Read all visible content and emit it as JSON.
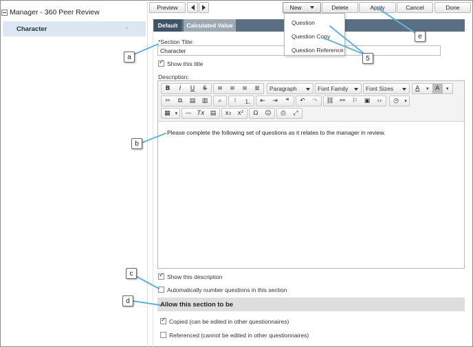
{
  "tree": {
    "root_label": "Manager - 360 Peer Review",
    "selected_item": "Character",
    "item_marker": "*"
  },
  "toolbar": {
    "preview": "Preview",
    "new": "New",
    "delete": "Delete",
    "apply": "Apply",
    "cancel": "Cancel",
    "done": "Done"
  },
  "new_menu": {
    "items": [
      "Question",
      "Question Copy",
      "Question Reference"
    ]
  },
  "tabs": {
    "default": "Default",
    "calculated": "Calculated Value"
  },
  "form": {
    "section_title_label": "*Section Title:",
    "section_title_value": "Character",
    "show_title_label": "Show this title",
    "show_title_checked": true,
    "description_label": "Description:",
    "description_text": "Please complete the following set of questions as it relates to the manager in review.",
    "show_description_label": "Show this description",
    "show_description_checked": true,
    "auto_number_label": "Automatically number questions in this section",
    "auto_number_checked": false,
    "allow_header": "Allow this section to be",
    "copied_label": "Copied (can be edited in other questionnaires)",
    "copied_checked": true,
    "referenced_label": "Referenced (cannot be edited in other questionnaires)",
    "referenced_checked": false
  },
  "editor_toolbar": {
    "paragraph": "Paragraph",
    "font_family": "Font Family",
    "font_sizes": "Font Sizes",
    "bold": "B",
    "italic": "I",
    "underline": "U",
    "strike": "S",
    "text_color": "A",
    "bg_color": "A"
  },
  "callouts": {
    "a": "a",
    "b": "b",
    "c": "c",
    "d": "d",
    "e": "e",
    "five": "5"
  },
  "colors": {
    "tab_active": "#3f5466",
    "tab_bar": "#5a6f82",
    "tree_selected": "#dde6f3",
    "callout_line": "#5bb3d6"
  }
}
